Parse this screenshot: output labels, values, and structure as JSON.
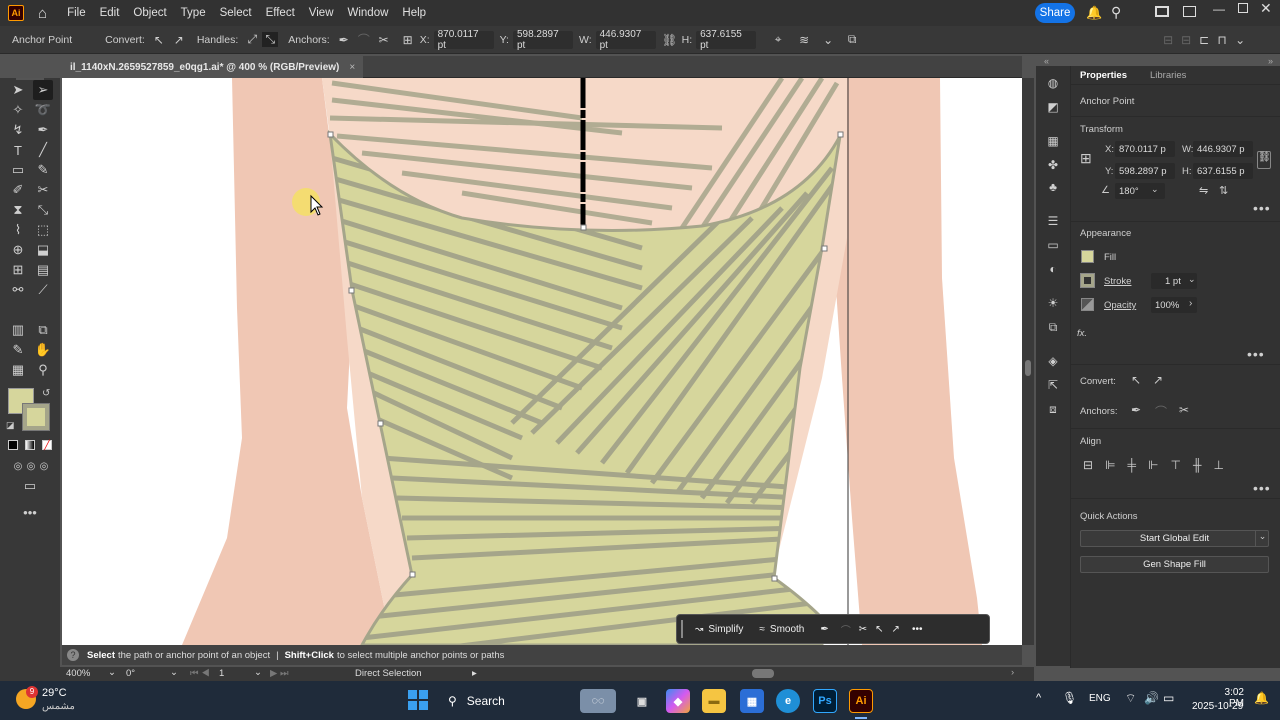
{
  "app": {
    "logo": "Ai",
    "share_label": "Share"
  },
  "menu": [
    "File",
    "Edit",
    "Object",
    "Type",
    "Select",
    "Effect",
    "View",
    "Window",
    "Help"
  ],
  "control": {
    "tool_name": "Anchor Point",
    "convert_label": "Convert:",
    "handles_label": "Handles:",
    "anchors_label": "Anchors:",
    "x_label": "X:",
    "x_value": "870.0117 pt",
    "y_label": "Y:",
    "y_value": "598.2897 pt",
    "w_label": "W:",
    "w_value": "446.9307 pt",
    "h_label": "H:",
    "h_value": "637.6155 pt"
  },
  "document": {
    "tab_title": "il_1140xN.2659527859_e0qg1.ai* @ 400 % (RGB/Preview)",
    "close": "×"
  },
  "panel": {
    "tab_properties": "Properties",
    "tab_libraries": "Libraries",
    "selection_type": "Anchor Point",
    "transform_title": "Transform",
    "x_label": "X:",
    "x_value": "870.0117 p",
    "y_label": "Y:",
    "y_value": "598.2897 p",
    "w_label": "W:",
    "w_value": "446.9307 p",
    "h_label": "H:",
    "h_value": "637.6155 p",
    "rotate_value": "180°",
    "appearance_title": "Appearance",
    "fill_label": "Fill",
    "stroke_label": "Stroke",
    "stroke_weight": "1 pt",
    "opacity_label": "Opacity",
    "opacity_value": "100%",
    "fx_label": "fx.",
    "convert_label": "Convert:",
    "anchors_label": "Anchors:",
    "align_title": "Align",
    "quick_actions_title": "Quick Actions",
    "start_global_edit": "Start Global Edit",
    "gen_shape_fill": "Gen Shape Fill"
  },
  "context_bar": {
    "simplify": "Simplify",
    "smooth": "Smooth"
  },
  "status": {
    "select_bold": "Select",
    "select_text": "the path or anchor point of an object",
    "sep": "|",
    "shift_bold": "Shift+Click",
    "shift_text": "to select multiple anchor points or paths",
    "zoom": "400%",
    "rotation": "0°",
    "artboard": "1",
    "tool": "Direct Selection"
  },
  "taskbar": {
    "weather_temp": "29°C",
    "weather_desc": "مشمس",
    "weather_badge": "9",
    "search_label": "Search",
    "lang": "ENG",
    "time": "3:02 PM",
    "date": "2025-10-29"
  },
  "colors": {
    "fill": "#d6d69c",
    "stroke": "#a5a58a",
    "skin": "#f2d2c0",
    "accent": "#1473e6"
  }
}
